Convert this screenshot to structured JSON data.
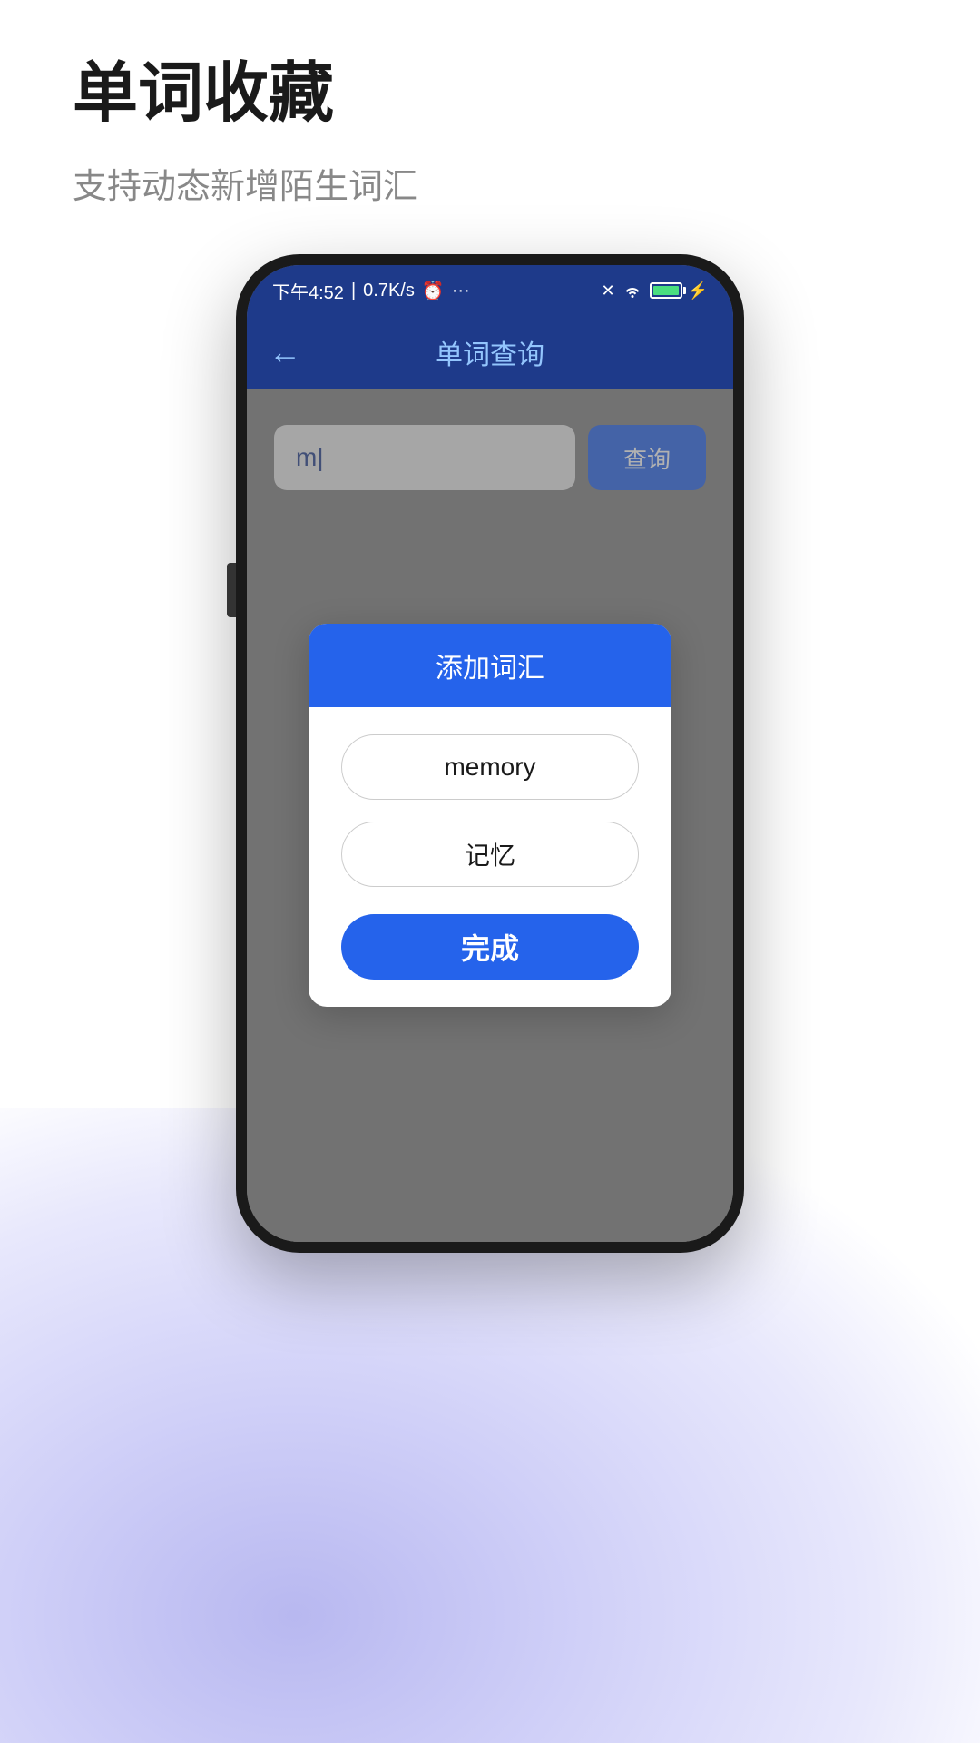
{
  "page": {
    "title": "单词收藏",
    "subtitle": "支持动态新增陌生词汇"
  },
  "status_bar": {
    "time": "下午4:52",
    "network": "0.7K/s",
    "battery": "100"
  },
  "app": {
    "back_label": "←",
    "title": "单词查询"
  },
  "search": {
    "input_value": "m|",
    "button_label": "查询"
  },
  "dialog": {
    "title": "添加词汇",
    "word_input": "memory",
    "translation_input": "记忆",
    "confirm_label": "完成"
  }
}
